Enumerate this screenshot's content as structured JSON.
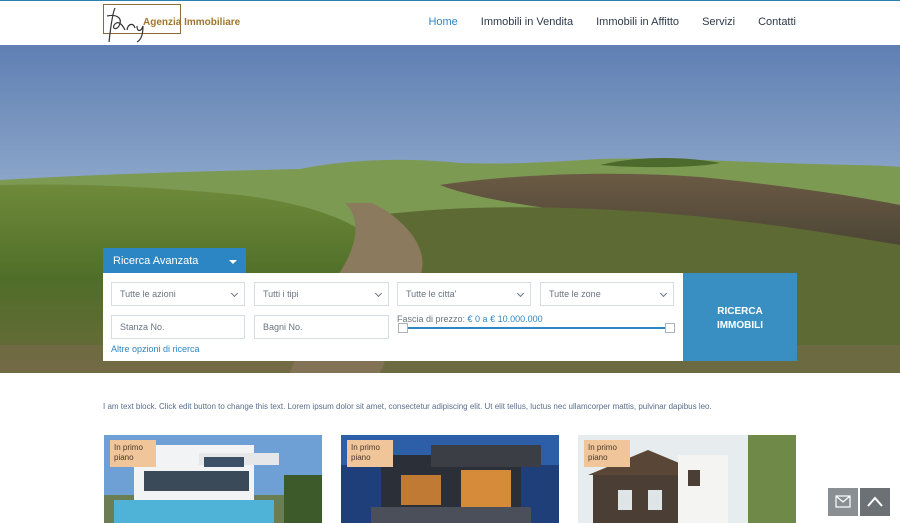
{
  "header": {
    "logo_text": "Agenzia Immobiliare",
    "nav": [
      {
        "label": "Home",
        "active": true
      },
      {
        "label": "Immobili in Vendita"
      },
      {
        "label": "Immobili in Affitto"
      },
      {
        "label": "Servizi"
      },
      {
        "label": "Contatti"
      }
    ]
  },
  "search": {
    "tab_label": "Ricerca Avanzata",
    "actions_select": "Tutte le azioni",
    "types_select": "Tutti i tipi",
    "cities_select": "Tutte le citta'",
    "zones_select": "Tutte le zone",
    "rooms_placeholder": "Stanza No.",
    "baths_placeholder": "Bagni No.",
    "price_label": "Fascia di prezzo:",
    "price_range": "€ 0 a € 10.000.000",
    "more_options": "Altre opzioni di ricerca",
    "button_line1": "RICERCA",
    "button_line2": "IMMOBILI"
  },
  "text_block": "I am text block. Click edit button to change this text. Lorem ipsum dolor sit amet, consectetur adipiscing elit. Ut elit tellus, luctus nec ullamcorper mattis, pulvinar dapibus leo.",
  "cards": [
    {
      "badge_line1": "In primo",
      "badge_line2": "piano"
    },
    {
      "badge_line1": "In primo",
      "badge_line2": "piano"
    },
    {
      "badge_line1": "In primo",
      "badge_line2": "piano"
    }
  ],
  "colors": {
    "accent": "#2d86c4",
    "badge": "#f0c59a"
  },
  "icons": {
    "mail": "mail-icon",
    "up": "arrow-up-icon"
  }
}
